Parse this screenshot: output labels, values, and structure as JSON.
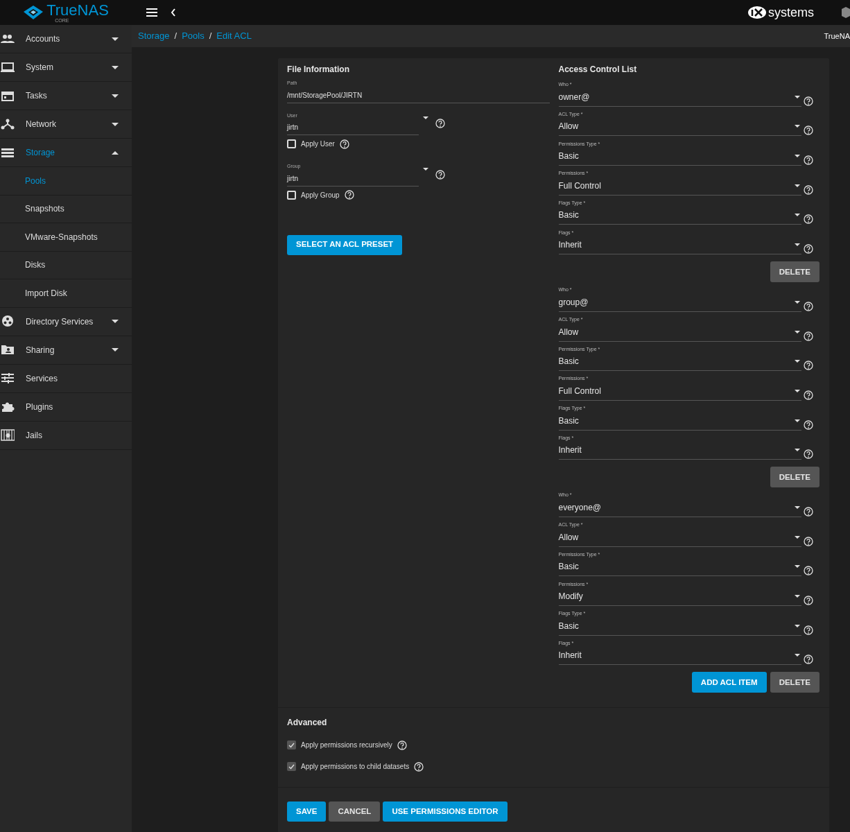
{
  "topbar": {
    "logo_text": "TrueNAS",
    "logo_subtext": "CORE",
    "vendor_text": "systems",
    "hostname": "TrueNA"
  },
  "sidebar": {
    "items": [
      {
        "label": "Accounts",
        "expanded": false,
        "selected": false
      },
      {
        "label": "System",
        "expanded": false,
        "selected": false
      },
      {
        "label": "Tasks",
        "expanded": false,
        "selected": false
      },
      {
        "label": "Network",
        "expanded": false,
        "selected": false
      },
      {
        "label": "Storage",
        "expanded": true,
        "selected": true,
        "children": [
          {
            "label": "Pools",
            "selected": true
          },
          {
            "label": "Snapshots",
            "selected": false
          },
          {
            "label": "VMware-Snapshots",
            "selected": false
          },
          {
            "label": "Disks",
            "selected": false
          },
          {
            "label": "Import Disk",
            "selected": false
          }
        ]
      },
      {
        "label": "Directory Services",
        "expanded": false,
        "selected": false
      },
      {
        "label": "Sharing",
        "expanded": false,
        "selected": false
      },
      {
        "label": "Services",
        "selected": false
      },
      {
        "label": "Plugins",
        "selected": false
      },
      {
        "label": "Jails",
        "selected": false
      }
    ]
  },
  "breadcrumb": {
    "items": [
      "Storage",
      "Pools",
      "Edit ACL"
    ],
    "separator": "/"
  },
  "file_information": {
    "title": "File Information",
    "path": {
      "label": "Path",
      "value": "/mnt/StoragePool/JIRTN"
    },
    "user": {
      "label": "User",
      "value": "jirtn",
      "apply_label": "Apply User",
      "apply_checked": false
    },
    "group": {
      "label": "Group",
      "value": "jirtn",
      "apply_label": "Apply Group",
      "apply_checked": false
    },
    "preset_button": "SELECT AN ACL PRESET"
  },
  "acl": {
    "title": "Access Control List",
    "entries": [
      {
        "fields": [
          {
            "label": "Who *",
            "value": "owner@"
          },
          {
            "label": "ACL Type *",
            "value": "Allow"
          },
          {
            "label": "Permissions Type *",
            "value": "Basic"
          },
          {
            "label": "Permissions *",
            "value": "Full Control"
          },
          {
            "label": "Flags Type *",
            "value": "Basic"
          },
          {
            "label": "Flags *",
            "value": "Inherit"
          }
        ],
        "delete_button": "DELETE"
      },
      {
        "fields": [
          {
            "label": "Who *",
            "value": "group@"
          },
          {
            "label": "ACL Type *",
            "value": "Allow"
          },
          {
            "label": "Permissions Type *",
            "value": "Basic"
          },
          {
            "label": "Permissions *",
            "value": "Full Control"
          },
          {
            "label": "Flags Type *",
            "value": "Basic"
          },
          {
            "label": "Flags *",
            "value": "Inherit"
          }
        ],
        "delete_button": "DELETE"
      },
      {
        "fields": [
          {
            "label": "Who *",
            "value": "everyone@"
          },
          {
            "label": "ACL Type *",
            "value": "Allow"
          },
          {
            "label": "Permissions Type *",
            "value": "Basic"
          },
          {
            "label": "Permissions *",
            "value": "Modify"
          },
          {
            "label": "Flags Type *",
            "value": "Basic"
          },
          {
            "label": "Flags *",
            "value": "Inherit"
          }
        ],
        "delete_button": "DELETE"
      }
    ],
    "add_button": "ADD ACL ITEM"
  },
  "advanced": {
    "title": "Advanced",
    "options": [
      {
        "label": "Apply permissions recursively",
        "checked": true
      },
      {
        "label": "Apply permissions to child datasets",
        "checked": true
      }
    ]
  },
  "actions": [
    {
      "label": "SAVE",
      "kind": "primary"
    },
    {
      "label": "CANCEL",
      "kind": "secondary"
    },
    {
      "label": "USE PERMISSIONS EDITOR",
      "kind": "primary"
    }
  ]
}
